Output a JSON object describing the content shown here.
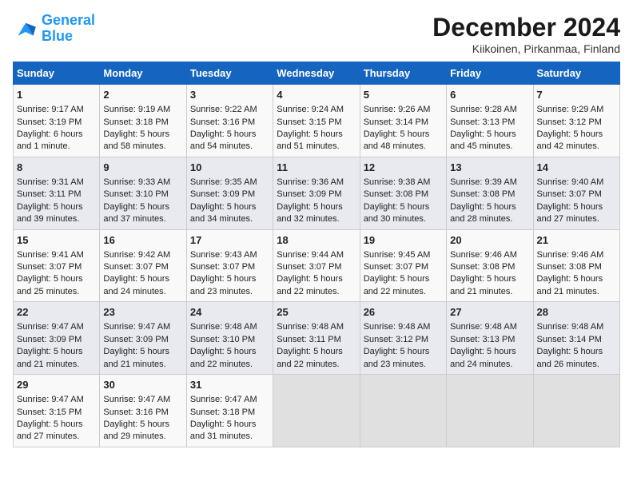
{
  "logo": {
    "line1": "General",
    "line2": "Blue"
  },
  "title": "December 2024",
  "location": "Kiikoinen, Pirkanmaa, Finland",
  "days_of_week": [
    "Sunday",
    "Monday",
    "Tuesday",
    "Wednesday",
    "Thursday",
    "Friday",
    "Saturday"
  ],
  "weeks": [
    [
      {
        "day": "1",
        "sunrise": "Sunrise: 9:17 AM",
        "sunset": "Sunset: 3:19 PM",
        "daylight": "Daylight: 6 hours and 1 minute."
      },
      {
        "day": "2",
        "sunrise": "Sunrise: 9:19 AM",
        "sunset": "Sunset: 3:18 PM",
        "daylight": "Daylight: 5 hours and 58 minutes."
      },
      {
        "day": "3",
        "sunrise": "Sunrise: 9:22 AM",
        "sunset": "Sunset: 3:16 PM",
        "daylight": "Daylight: 5 hours and 54 minutes."
      },
      {
        "day": "4",
        "sunrise": "Sunrise: 9:24 AM",
        "sunset": "Sunset: 3:15 PM",
        "daylight": "Daylight: 5 hours and 51 minutes."
      },
      {
        "day": "5",
        "sunrise": "Sunrise: 9:26 AM",
        "sunset": "Sunset: 3:14 PM",
        "daylight": "Daylight: 5 hours and 48 minutes."
      },
      {
        "day": "6",
        "sunrise": "Sunrise: 9:28 AM",
        "sunset": "Sunset: 3:13 PM",
        "daylight": "Daylight: 5 hours and 45 minutes."
      },
      {
        "day": "7",
        "sunrise": "Sunrise: 9:29 AM",
        "sunset": "Sunset: 3:12 PM",
        "daylight": "Daylight: 5 hours and 42 minutes."
      }
    ],
    [
      {
        "day": "8",
        "sunrise": "Sunrise: 9:31 AM",
        "sunset": "Sunset: 3:11 PM",
        "daylight": "Daylight: 5 hours and 39 minutes."
      },
      {
        "day": "9",
        "sunrise": "Sunrise: 9:33 AM",
        "sunset": "Sunset: 3:10 PM",
        "daylight": "Daylight: 5 hours and 37 minutes."
      },
      {
        "day": "10",
        "sunrise": "Sunrise: 9:35 AM",
        "sunset": "Sunset: 3:09 PM",
        "daylight": "Daylight: 5 hours and 34 minutes."
      },
      {
        "day": "11",
        "sunrise": "Sunrise: 9:36 AM",
        "sunset": "Sunset: 3:09 PM",
        "daylight": "Daylight: 5 hours and 32 minutes."
      },
      {
        "day": "12",
        "sunrise": "Sunrise: 9:38 AM",
        "sunset": "Sunset: 3:08 PM",
        "daylight": "Daylight: 5 hours and 30 minutes."
      },
      {
        "day": "13",
        "sunrise": "Sunrise: 9:39 AM",
        "sunset": "Sunset: 3:08 PM",
        "daylight": "Daylight: 5 hours and 28 minutes."
      },
      {
        "day": "14",
        "sunrise": "Sunrise: 9:40 AM",
        "sunset": "Sunset: 3:07 PM",
        "daylight": "Daylight: 5 hours and 27 minutes."
      }
    ],
    [
      {
        "day": "15",
        "sunrise": "Sunrise: 9:41 AM",
        "sunset": "Sunset: 3:07 PM",
        "daylight": "Daylight: 5 hours and 25 minutes."
      },
      {
        "day": "16",
        "sunrise": "Sunrise: 9:42 AM",
        "sunset": "Sunset: 3:07 PM",
        "daylight": "Daylight: 5 hours and 24 minutes."
      },
      {
        "day": "17",
        "sunrise": "Sunrise: 9:43 AM",
        "sunset": "Sunset: 3:07 PM",
        "daylight": "Daylight: 5 hours and 23 minutes."
      },
      {
        "day": "18",
        "sunrise": "Sunrise: 9:44 AM",
        "sunset": "Sunset: 3:07 PM",
        "daylight": "Daylight: 5 hours and 22 minutes."
      },
      {
        "day": "19",
        "sunrise": "Sunrise: 9:45 AM",
        "sunset": "Sunset: 3:07 PM",
        "daylight": "Daylight: 5 hours and 22 minutes."
      },
      {
        "day": "20",
        "sunrise": "Sunrise: 9:46 AM",
        "sunset": "Sunset: 3:08 PM",
        "daylight": "Daylight: 5 hours and 21 minutes."
      },
      {
        "day": "21",
        "sunrise": "Sunrise: 9:46 AM",
        "sunset": "Sunset: 3:08 PM",
        "daylight": "Daylight: 5 hours and 21 minutes."
      }
    ],
    [
      {
        "day": "22",
        "sunrise": "Sunrise: 9:47 AM",
        "sunset": "Sunset: 3:09 PM",
        "daylight": "Daylight: 5 hours and 21 minutes."
      },
      {
        "day": "23",
        "sunrise": "Sunrise: 9:47 AM",
        "sunset": "Sunset: 3:09 PM",
        "daylight": "Daylight: 5 hours and 21 minutes."
      },
      {
        "day": "24",
        "sunrise": "Sunrise: 9:48 AM",
        "sunset": "Sunset: 3:10 PM",
        "daylight": "Daylight: 5 hours and 22 minutes."
      },
      {
        "day": "25",
        "sunrise": "Sunrise: 9:48 AM",
        "sunset": "Sunset: 3:11 PM",
        "daylight": "Daylight: 5 hours and 22 minutes."
      },
      {
        "day": "26",
        "sunrise": "Sunrise: 9:48 AM",
        "sunset": "Sunset: 3:12 PM",
        "daylight": "Daylight: 5 hours and 23 minutes."
      },
      {
        "day": "27",
        "sunrise": "Sunrise: 9:48 AM",
        "sunset": "Sunset: 3:13 PM",
        "daylight": "Daylight: 5 hours and 24 minutes."
      },
      {
        "day": "28",
        "sunrise": "Sunrise: 9:48 AM",
        "sunset": "Sunset: 3:14 PM",
        "daylight": "Daylight: 5 hours and 26 minutes."
      }
    ],
    [
      {
        "day": "29",
        "sunrise": "Sunrise: 9:47 AM",
        "sunset": "Sunset: 3:15 PM",
        "daylight": "Daylight: 5 hours and 27 minutes."
      },
      {
        "day": "30",
        "sunrise": "Sunrise: 9:47 AM",
        "sunset": "Sunset: 3:16 PM",
        "daylight": "Daylight: 5 hours and 29 minutes."
      },
      {
        "day": "31",
        "sunrise": "Sunrise: 9:47 AM",
        "sunset": "Sunset: 3:18 PM",
        "daylight": "Daylight: 5 hours and 31 minutes."
      },
      {
        "day": "",
        "sunrise": "",
        "sunset": "",
        "daylight": ""
      },
      {
        "day": "",
        "sunrise": "",
        "sunset": "",
        "daylight": ""
      },
      {
        "day": "",
        "sunrise": "",
        "sunset": "",
        "daylight": ""
      },
      {
        "day": "",
        "sunrise": "",
        "sunset": "",
        "daylight": ""
      }
    ]
  ]
}
